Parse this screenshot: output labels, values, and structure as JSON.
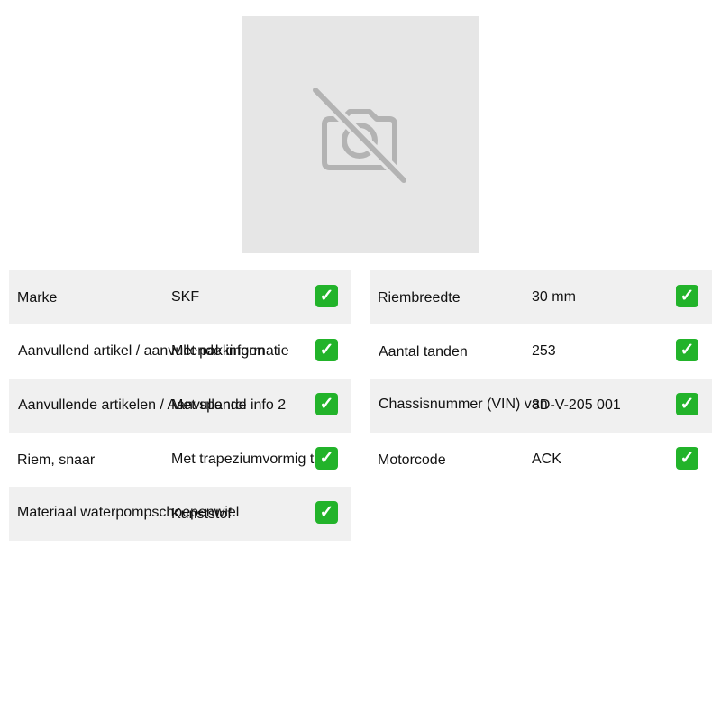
{
  "image": {
    "icon": "no-camera-icon"
  },
  "colors": {
    "placeholder_bg": "#e6e6e6",
    "placeholder_icon": "#b3b3b3",
    "row_shade": "#f0f0f0",
    "check_green": "#22b32a"
  },
  "left_table": [
    {
      "label": "Marke",
      "value": "SKF",
      "check": "✓"
    },
    {
      "label": "Aanvullend artikel / aanvullende informatie",
      "value": "Met pakkingen",
      "check": "✓"
    },
    {
      "label": "Aanvullende artikelen / Aanvullende info 2",
      "value": "Met spanrol",
      "check": "✓"
    },
    {
      "label": "Riem, snaar",
      "value": "Met trapeziumvormig tand",
      "check": "✓"
    },
    {
      "label": "Materiaal waterpompschoepenwiel",
      "value": "Kunststof",
      "check": "✓"
    }
  ],
  "right_table": [
    {
      "label": "Riembreedte",
      "value": "30 mm",
      "check": "✓"
    },
    {
      "label": "Aantal tanden",
      "value": "253",
      "check": "✓"
    },
    {
      "label": "Chassisnummer (VIN) van",
      "value": "8D-V-205 001",
      "check": "✓"
    },
    {
      "label": "Motorcode",
      "value": "ACK",
      "check": "✓"
    }
  ]
}
